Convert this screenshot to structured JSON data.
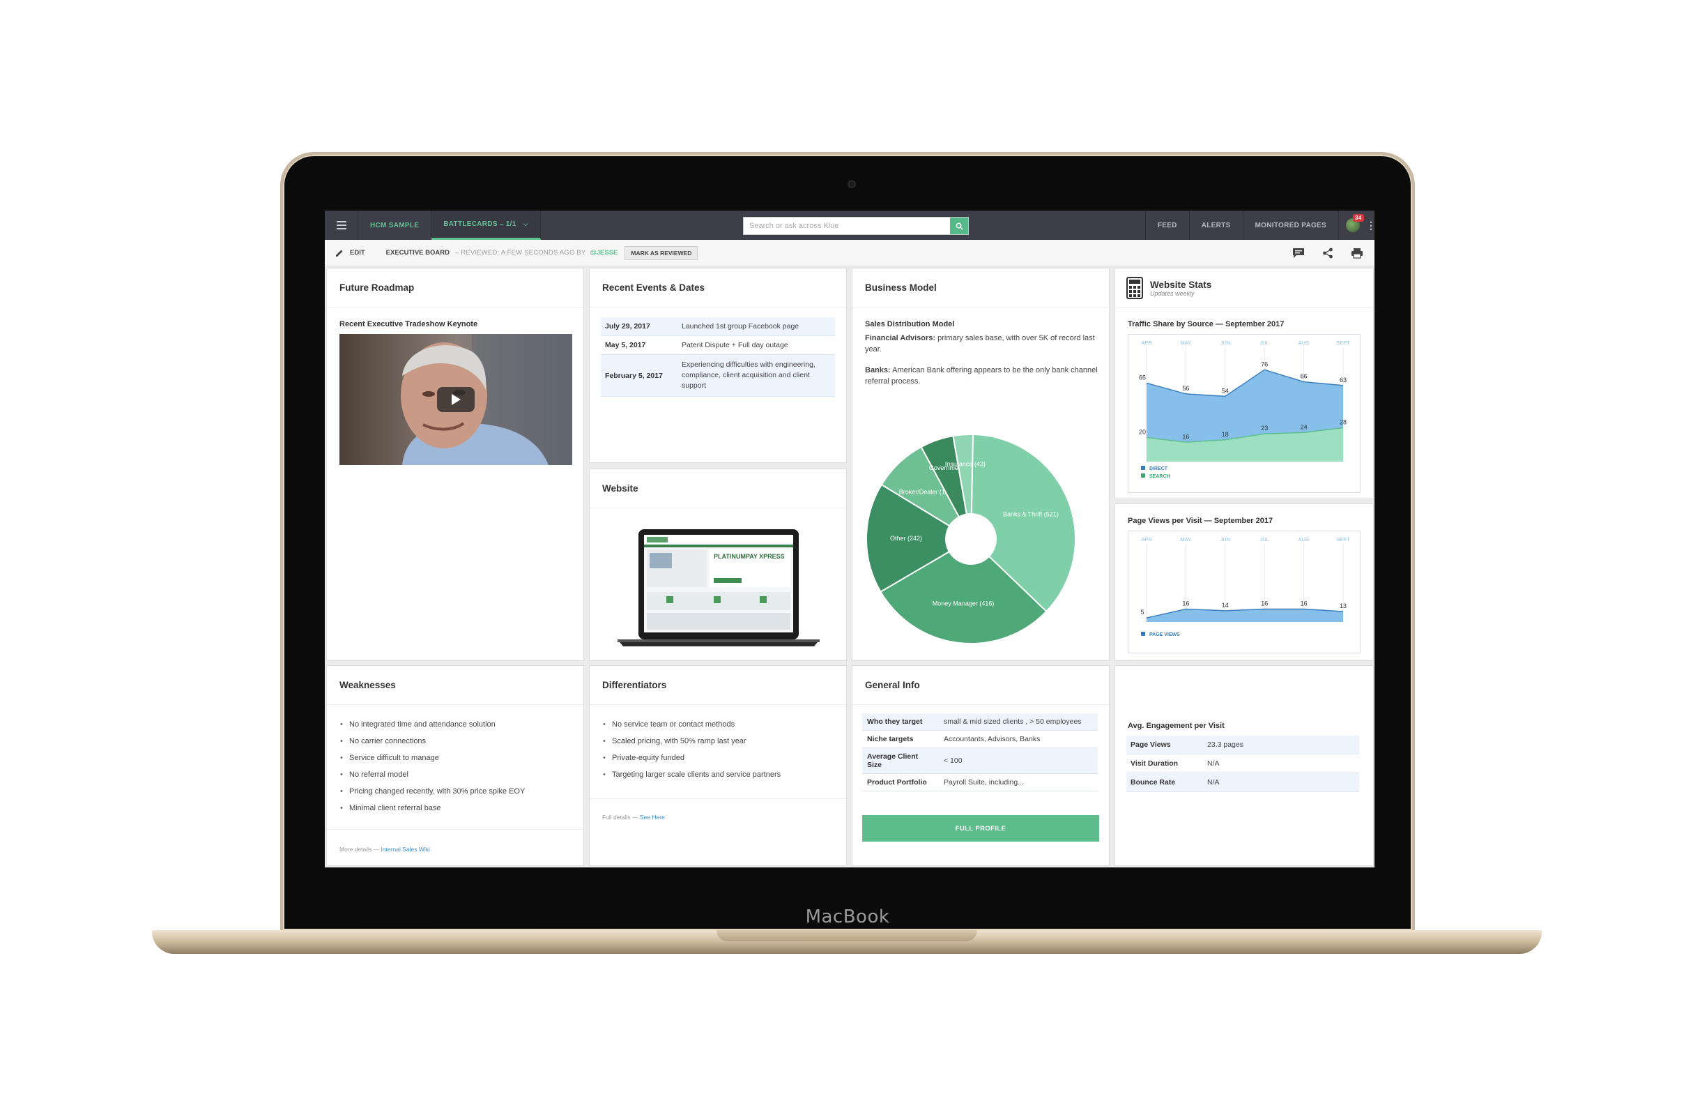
{
  "device": {
    "brand": "MacBook"
  },
  "topbar": {
    "tabs": [
      {
        "label": "HCM SAMPLE"
      },
      {
        "label": "BATTLECARDS – 1/1"
      }
    ],
    "search_placeholder": "Search or ask across Klue",
    "nav": [
      "FEED",
      "ALERTS",
      "MONITORED PAGES"
    ],
    "notification_count": "34"
  },
  "subbar": {
    "edit": "EDIT",
    "board": "EXECUTIVE BOARD",
    "reviewed": "– REVIEWED: A FEW SECONDS AGO BY",
    "user": "@JESSE",
    "mark": "MARK AS REVIEWED"
  },
  "roadmap": {
    "title": "Future Roadmap",
    "video_caption": "Recent Executive Tradeshow Keynote"
  },
  "events": {
    "title": "Recent Events & Dates",
    "rows": [
      {
        "date": "July 29, 2017",
        "text": "Launched 1st group Facebook page"
      },
      {
        "date": "May 5, 2017",
        "text": "Patent Dispute + Full day outage"
      },
      {
        "date": "February 5, 2017",
        "text": "Experiencing difficulties with engineering, compliance, client acquisition and client support"
      }
    ]
  },
  "website": {
    "title": "Website",
    "screenshot_headline": "PLATINUMPAY XPRESS"
  },
  "business": {
    "title": "Business Model",
    "subtitle": "Sales Distribution Model",
    "fa_label": "Financial Advisors:",
    "fa_text": "primary sales base, with over 5K of record last year.",
    "banks_label": "Banks:",
    "banks_text": "American Bank offering appears to be the only bank channel referral process."
  },
  "weaknesses": {
    "title": "Weaknesses",
    "items": [
      "No integrated time and attendance solution",
      "No carrier connections",
      "Service difficult to manage",
      "No referral model",
      "Pricing changed recently, with 30% price spike EOY",
      "Minimal client referral base"
    ],
    "foot_prefix": "More details —",
    "foot_link": "Internal Sales Wiki"
  },
  "differentiators": {
    "title": "Differentiators",
    "items": [
      "No service team or contact methods",
      "Scaled pricing, with 50% ramp last year",
      "Private-equity funded",
      "Targeting larger scale clients and service partners"
    ],
    "foot_prefix": "Full details —",
    "foot_link": "See Here"
  },
  "general": {
    "title": "General Info",
    "rows": [
      {
        "k": "Who they target",
        "v": "small & mid sized clients , > 50 employees"
      },
      {
        "k": "Niche targets",
        "v": "Accountants, Advisors, Banks"
      },
      {
        "k": "Average Client Size",
        "v": "< 100"
      },
      {
        "k": "Product Portfolio",
        "v": "Payroll Suite, including..."
      }
    ],
    "button": "FULL PROFILE"
  },
  "stats": {
    "title": "Website Stats",
    "subtitle": "Updates weekly",
    "engagement_title": "Avg. Engagement per Visit",
    "engagement_rows": [
      {
        "k": "Page Views",
        "v": "23.3 pages"
      },
      {
        "k": "Visit Duration",
        "v": "N/A"
      },
      {
        "k": "Bounce Rate",
        "v": "N/A"
      }
    ]
  },
  "chart_data": [
    {
      "type": "pie",
      "title": "",
      "series": [
        {
          "name": "",
          "values": [
            521,
            416,
            242,
            119,
            73,
            43
          ]
        }
      ],
      "labels": [
        "Banks & Thrift (521)",
        "Money Manager (416)",
        "Other (242)",
        "Broker/Dealer (119)",
        "Government",
        "Insurance (43)"
      ],
      "colors": [
        "#7fcfa8",
        "#4ea878",
        "#3c8f63",
        "#6ebf93",
        "#3a8a5e",
        "#8fd5b2"
      ]
    },
    {
      "type": "area",
      "title": "Traffic Share by Source — September 2017",
      "x": [
        "APR",
        "MAY",
        "JUN",
        "JUL",
        "AUG",
        "SEPT"
      ],
      "series": [
        {
          "name": "DIRECT",
          "values": [
            65,
            56,
            54,
            76,
            66,
            63
          ],
          "color": "#7fbce8"
        },
        {
          "name": "SEARCH",
          "values": [
            20,
            16,
            18,
            23,
            24,
            28
          ],
          "color": "#9ee0bf"
        }
      ],
      "ylim": [
        0,
        90
      ]
    },
    {
      "type": "area",
      "title": "Page Views per Visit — September 2017",
      "x": [
        "APR",
        "MAY",
        "JUN",
        "JUL",
        "AUG",
        "SEPT"
      ],
      "series": [
        {
          "name": "PAGE VIEWS",
          "values": [
            5,
            16,
            14,
            16,
            16,
            13
          ],
          "color": "#7fbce8"
        }
      ],
      "ylim": [
        0,
        90
      ]
    }
  ]
}
